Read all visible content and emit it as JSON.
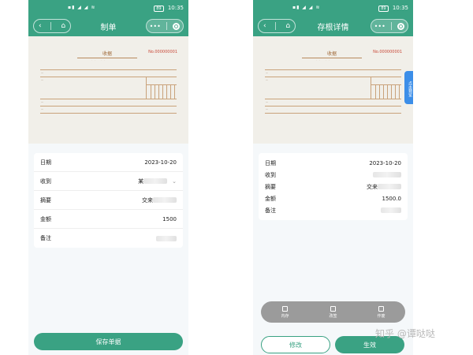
{
  "status": {
    "time": "10:35",
    "battery": "89"
  },
  "left": {
    "title": "制单",
    "receipt": {
      "title": "收据",
      "no": "No.000000001"
    },
    "fields": [
      {
        "label": "日期",
        "value": "2023-10-20"
      },
      {
        "label": "收到",
        "value": "某"
      },
      {
        "label": "摘要",
        "value": "交来"
      },
      {
        "label": "金额",
        "value": "1500"
      },
      {
        "label": "备注",
        "value": ""
      }
    ],
    "save_label": "保存单据"
  },
  "right": {
    "title": "存根详情",
    "receipt": {
      "title": "收据",
      "no": "No.000000001"
    },
    "side_tab": "点击预览",
    "fields": [
      {
        "label": "日期",
        "value": "2023-10-20"
      },
      {
        "label": "收到",
        "value": ""
      },
      {
        "label": "摘要",
        "value": "交来"
      },
      {
        "label": "金额",
        "value": "1500.0"
      },
      {
        "label": "备注",
        "value": ""
      }
    ],
    "actions": [
      "内存",
      "改签",
      "作废"
    ],
    "edit_label": "修改",
    "apply_label": "生效"
  },
  "watermark": "知乎 @谭哒哒"
}
